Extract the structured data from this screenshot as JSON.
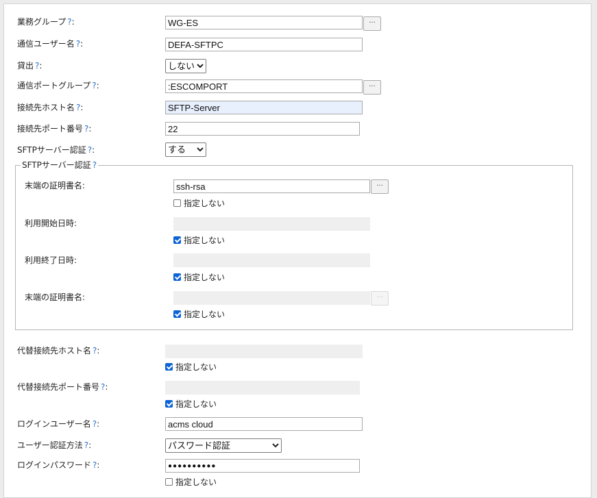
{
  "help_mark": "?",
  "fields": {
    "business_group": {
      "label": "業務グループ",
      "value": "WG-ES",
      "browse": "···"
    },
    "comm_user": {
      "label": "通信ユーザー名",
      "value": "DEFA-SFTPC"
    },
    "lending": {
      "label": "貸出",
      "selected": "しない"
    },
    "comm_port_group": {
      "label": "通信ポートグループ",
      "value": ":ESCOMPORT",
      "browse": "···"
    },
    "dest_host": {
      "label": "接続先ホスト名",
      "value": "SFTP-Server"
    },
    "dest_port": {
      "label": "接続先ポート番号",
      "value": "22"
    },
    "sftp_auth": {
      "label": "SFTPサーバー認証",
      "selected": "する"
    }
  },
  "sftp_section": {
    "legend": "SFTPサーバー認証",
    "cert_name_1": {
      "label": "末端の証明書名:",
      "value": "ssh-rsa",
      "browse": "···",
      "unspecified": "指定しない",
      "checked": false
    },
    "start_date": {
      "label": "利用開始日時:",
      "value": "",
      "unspecified": "指定しない",
      "checked": true
    },
    "end_date": {
      "label": "利用終了日時:",
      "value": "",
      "unspecified": "指定しない",
      "checked": true
    },
    "cert_name_2": {
      "label": "末端の証明書名:",
      "value": "",
      "browse": "···",
      "unspecified": "指定しない",
      "checked": true
    }
  },
  "alt": {
    "alt_host": {
      "label": "代替接続先ホスト名",
      "value": "",
      "unspecified": "指定しない",
      "checked": true
    },
    "alt_port": {
      "label": "代替接続先ポート番号",
      "value": "",
      "unspecified": "指定しない",
      "checked": true
    }
  },
  "login": {
    "user": {
      "label": "ログインユーザー名",
      "value": "acms cloud"
    },
    "auth_method": {
      "label": "ユーザー認証方法",
      "selected": "パスワード認証"
    },
    "password": {
      "label": "ログインパスワード",
      "masked": "●●●●●●●●●●",
      "unspecified": "指定しない",
      "checked": false
    }
  },
  "colors": {
    "help": "#2a72c9",
    "checkbox": "#0b63d6",
    "autofill": "#e8f0fe",
    "disabled": "#efefef"
  }
}
